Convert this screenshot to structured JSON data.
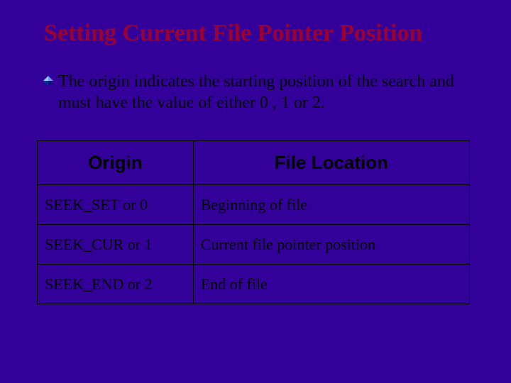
{
  "title": "Setting Current File Pointer Position",
  "bullet": {
    "text": "The origin indicates the starting position of the search and must have  the value of either 0 , 1 or 2."
  },
  "table": {
    "headers": {
      "origin": "Origin",
      "location": "File Location"
    },
    "rows": [
      {
        "origin": "SEEK_SET or 0",
        "location": "Beginning of file"
      },
      {
        "origin": "SEEK_CUR or 1",
        "location": "Current file pointer position"
      },
      {
        "origin": "SEEK_END or 2",
        "location": "End of file"
      }
    ]
  }
}
